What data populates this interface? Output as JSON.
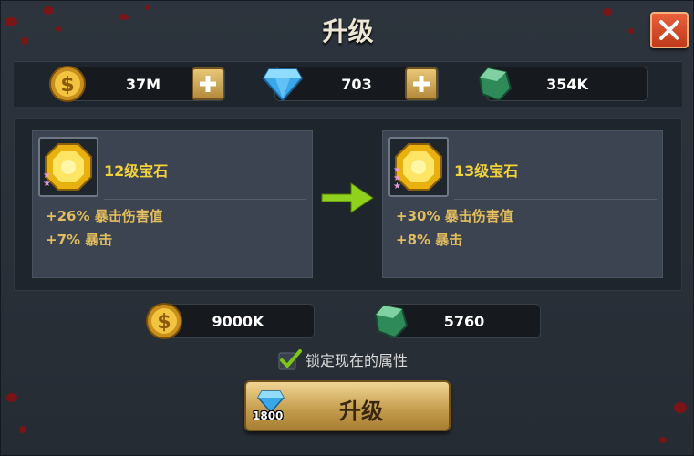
{
  "dialog": {
    "title": "升级"
  },
  "currencies": {
    "gold": {
      "value": "37M",
      "icon": "gold-coin-icon"
    },
    "diamond": {
      "value": "703",
      "icon": "diamond-icon"
    },
    "stone": {
      "value": "354K",
      "icon": "green-stone-icon"
    }
  },
  "current_gem": {
    "title": "12级宝石",
    "stats": [
      "+26% 暴击伤害值",
      "+7% 暴击"
    ]
  },
  "next_gem": {
    "title": "13级宝石",
    "stats": [
      "+30% 暴击伤害值",
      "+8% 暴击"
    ]
  },
  "cost": {
    "gold": "9000K",
    "stone": "5760"
  },
  "lock": {
    "label": "锁定现在的属性",
    "checked": true
  },
  "upgrade_button": {
    "label": "升级",
    "diamond_price": "1800"
  },
  "colors": {
    "title_gold": "#f2d23a",
    "stat_text": "#e3bd5d",
    "button_gold": "#c39b4c",
    "close_red": "#d44a28"
  }
}
